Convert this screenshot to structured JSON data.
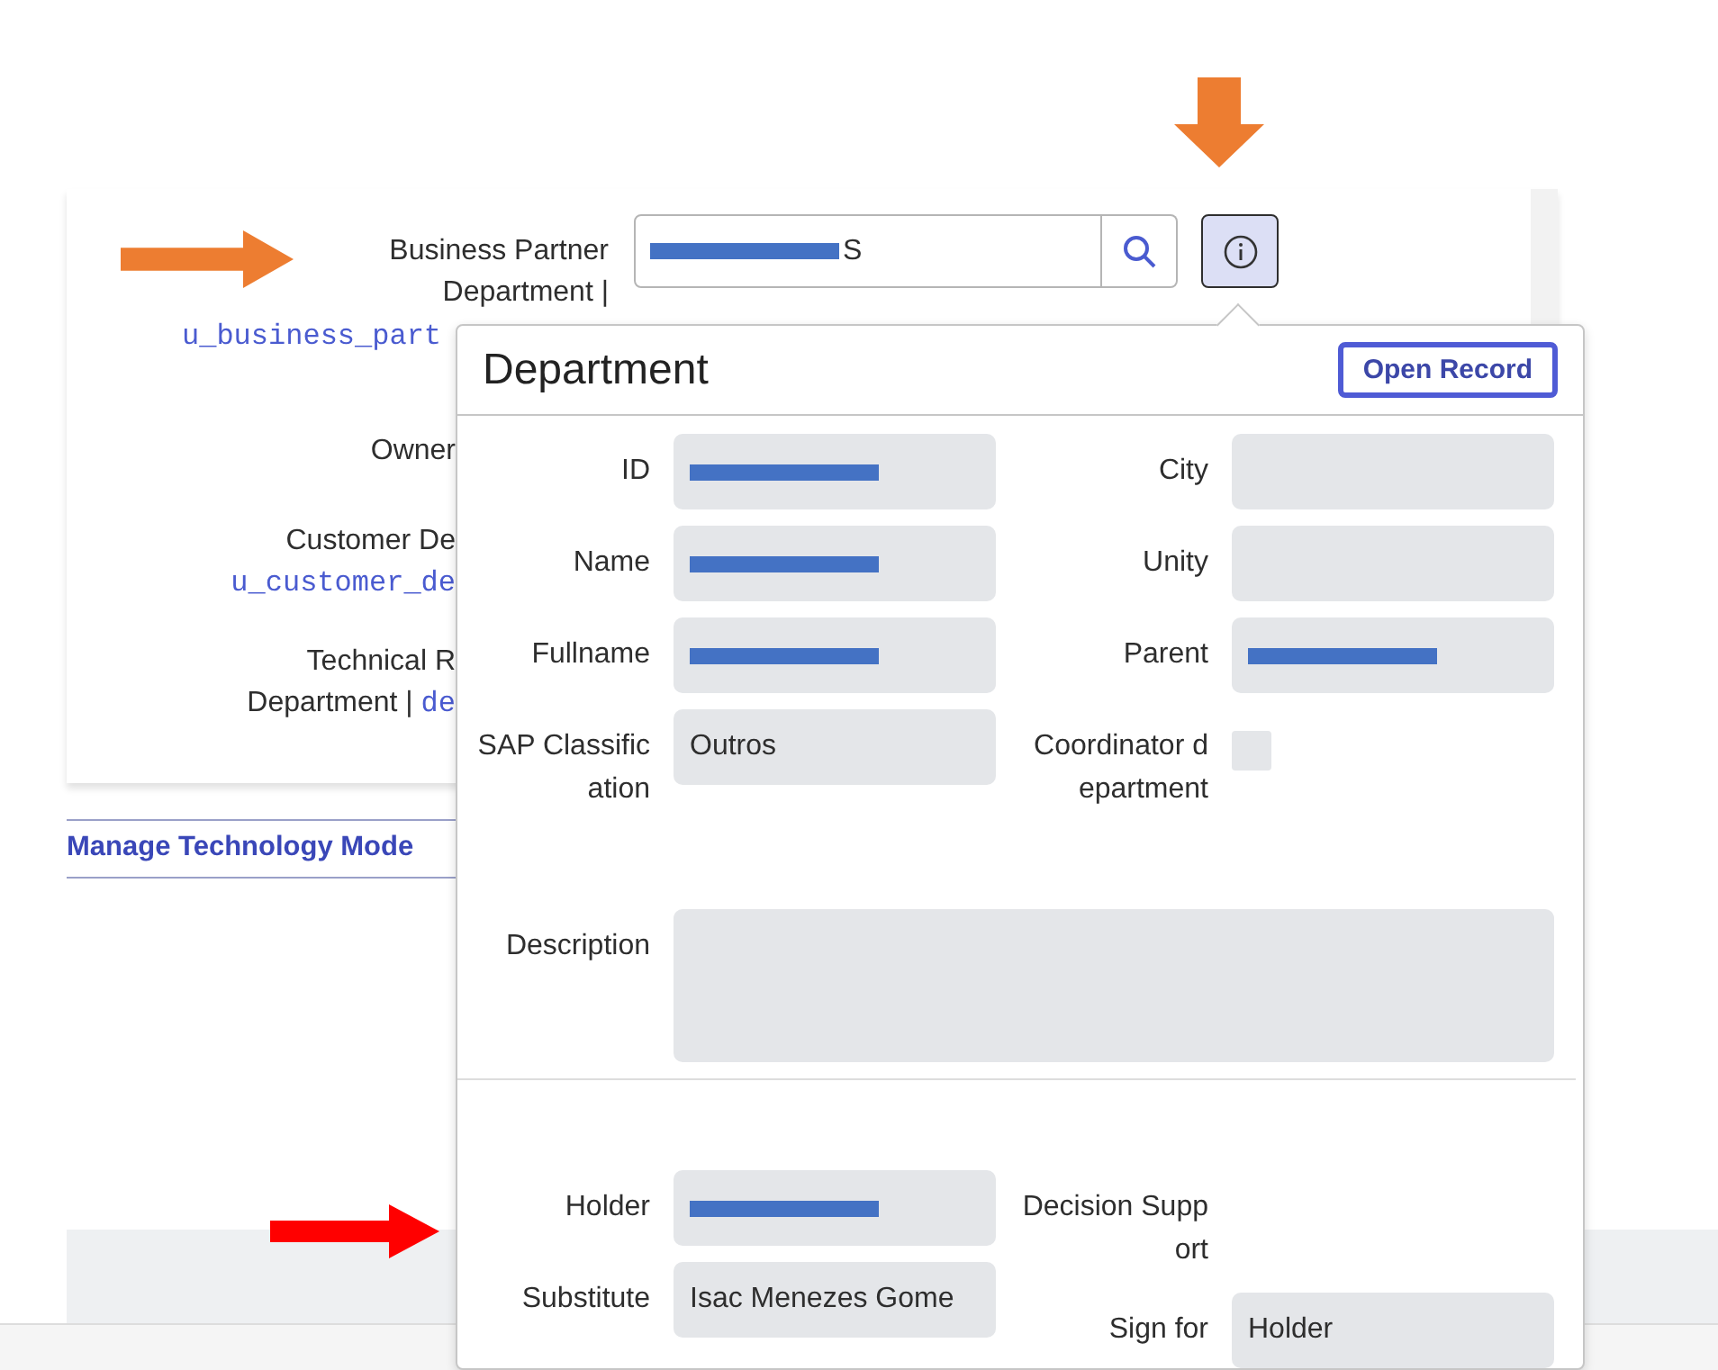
{
  "background_form": {
    "business_partner": {
      "label": "Business Partner Department |",
      "column": "u_business_part",
      "value": "S",
      "redacted": true
    },
    "owner_label": "Owner",
    "customer": {
      "label": "Customer De",
      "column": "u_customer_de"
    },
    "technical": {
      "label": "Technical R",
      "label_2": "Department |",
      "column": "de"
    },
    "related_link": "Manage Technology Mode"
  },
  "popover": {
    "title": "Department",
    "open_button": "Open Record",
    "rows": [
      [
        {
          "kind": "text",
          "label": "ID",
          "redacted": true
        },
        {
          "kind": "text",
          "label": "City"
        }
      ],
      [
        {
          "kind": "text",
          "label": "Name",
          "redacted": true
        },
        {
          "kind": "text",
          "label": "Unity"
        }
      ],
      [
        {
          "kind": "text",
          "label": "Fullname",
          "redacted": true
        },
        {
          "kind": "text",
          "label": "Parent",
          "redacted": true
        }
      ],
      [
        {
          "kind": "text",
          "label": "SAP Classification",
          "value": "Outros"
        },
        {
          "kind": "checkbox",
          "label": "Coordinator department",
          "checked": false
        }
      ]
    ],
    "description": {
      "label": "Description"
    },
    "people_left": [
      {
        "kind": "text",
        "label": "Holder",
        "redacted": true
      },
      {
        "kind": "text",
        "label": "Substitute",
        "value": "Isac Menezes Gome"
      }
    ],
    "people_right": [
      {
        "kind": "label_only",
        "label": "Decision Support"
      },
      {
        "kind": "text",
        "label": "Sign for",
        "value": "Holder"
      }
    ]
  },
  "annotations": [
    {
      "kind": "right",
      "color": "#ed7d31"
    },
    {
      "kind": "down",
      "color": "#ed7d31"
    },
    {
      "kind": "right",
      "color": "#ff0000"
    }
  ]
}
